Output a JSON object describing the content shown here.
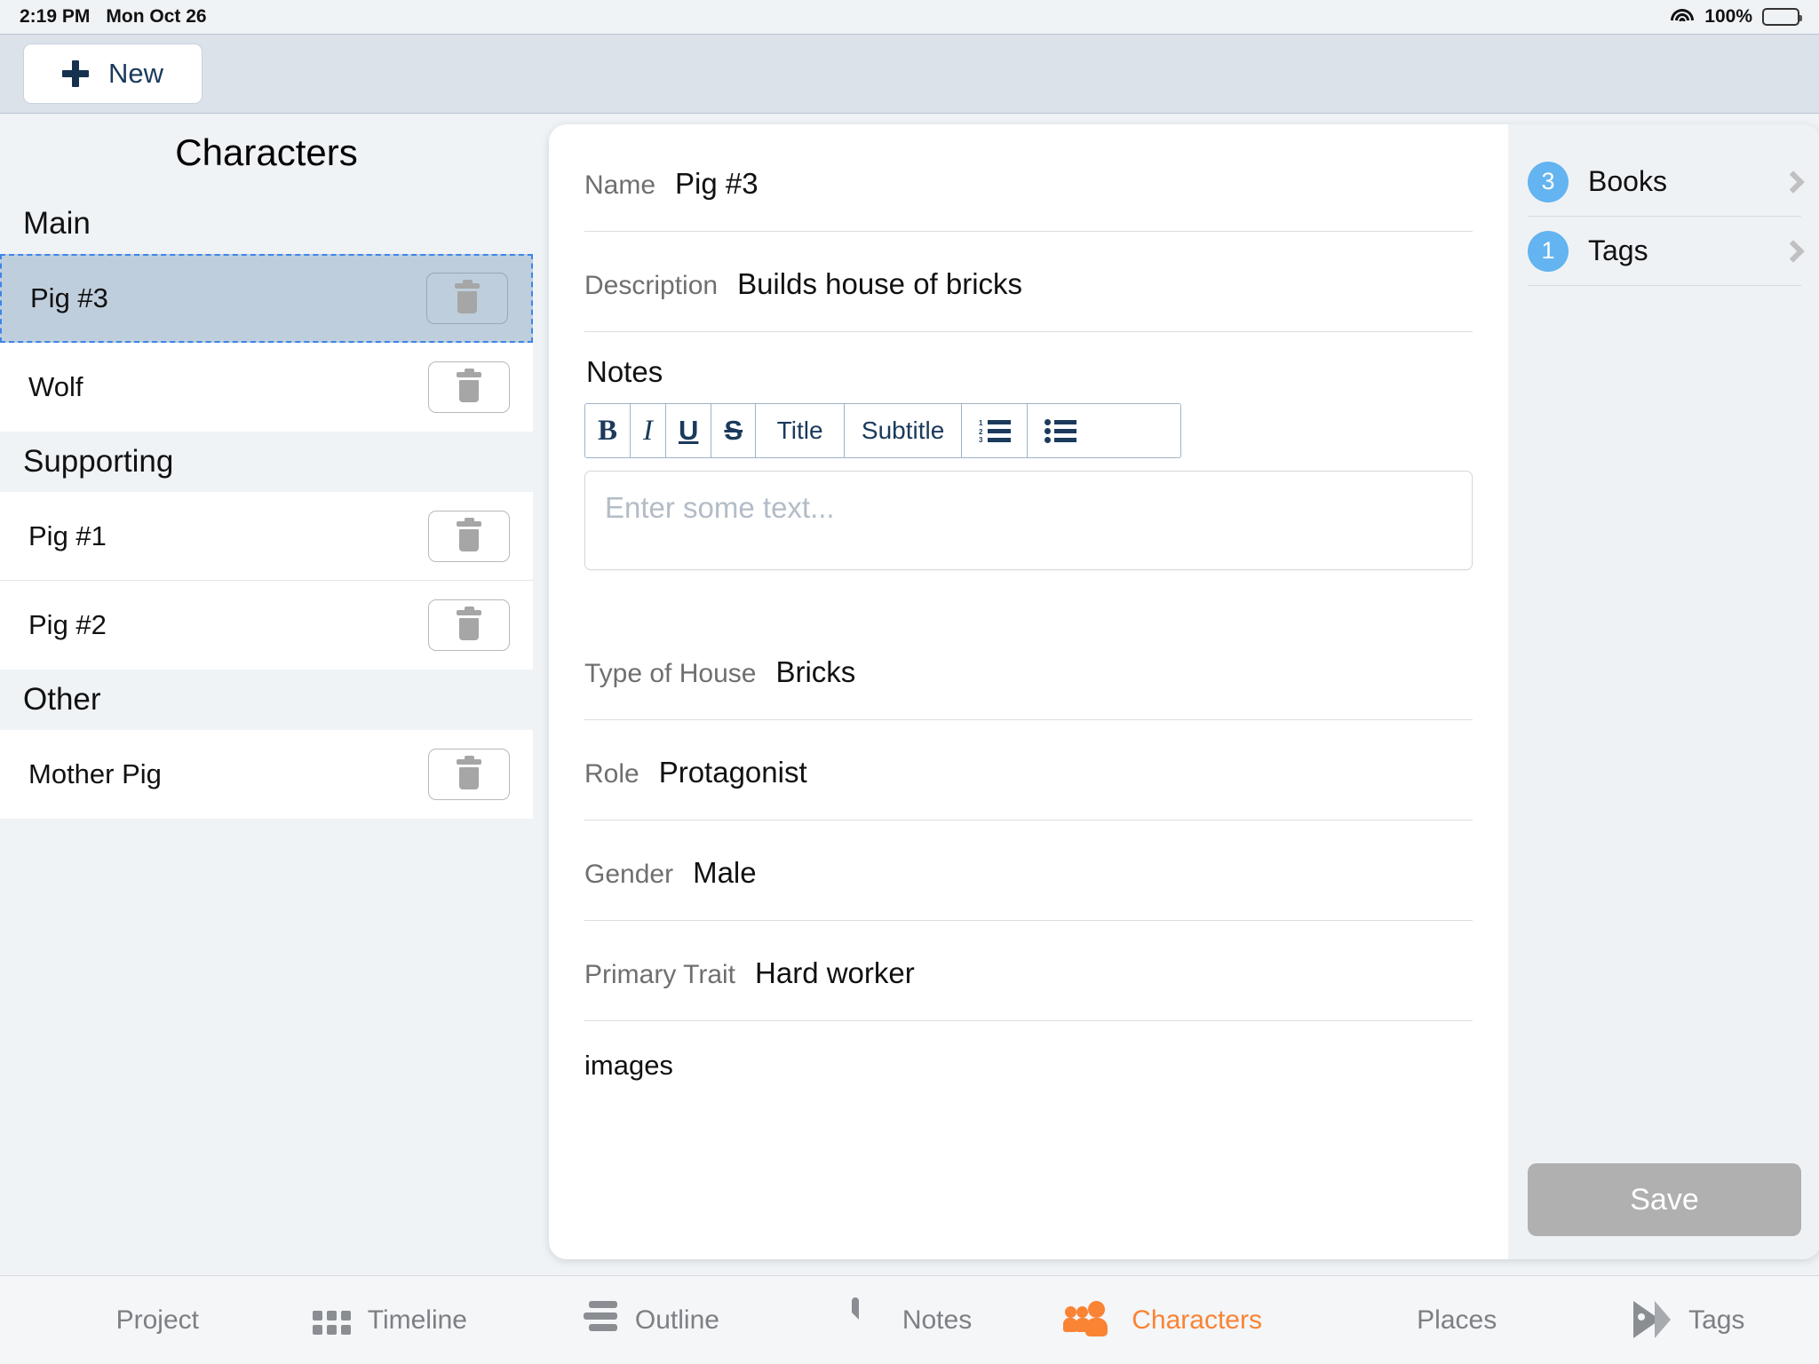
{
  "status_bar": {
    "time": "2:19 PM",
    "date": "Mon Oct 26",
    "battery_percent": "100%",
    "wifi_icon": "wifi-icon",
    "battery_icon": "battery-full-icon"
  },
  "nav_bar": {
    "new_label": "New",
    "plus_icon": "plus-icon"
  },
  "sidebar": {
    "title": "Characters",
    "delete_icon": "trash-icon",
    "groups": [
      {
        "header": "Main",
        "items": [
          {
            "name": "Pig #3",
            "selected": true
          },
          {
            "name": "Wolf",
            "selected": false
          }
        ]
      },
      {
        "header": "Supporting",
        "items": [
          {
            "name": "Pig #1",
            "selected": false
          },
          {
            "name": "Pig #2",
            "selected": false
          }
        ]
      },
      {
        "header": "Other",
        "items": [
          {
            "name": "Mother Pig",
            "selected": false
          }
        ]
      }
    ]
  },
  "detail": {
    "name_label": "Name",
    "name_value": "Pig #3",
    "description_label": "Description",
    "description_value": "Builds house of bricks",
    "notes_label": "Notes",
    "notes_placeholder": "Enter some text...",
    "notes_value": "",
    "toolbar": {
      "bold": "B",
      "italic": "I",
      "underline": "U",
      "strikethrough": "S",
      "title": "Title",
      "subtitle": "Subtitle",
      "ordered_list_icon": "ordered-list-icon",
      "bullet_list_icon": "bullet-list-icon"
    },
    "type_of_house_label": "Type of House",
    "type_of_house_value": "Bricks",
    "role_label": "Role",
    "role_value": "Protagonist",
    "gender_label": "Gender",
    "gender_value": "Male",
    "primary_trait_label": "Primary Trait",
    "primary_trait_value": "Hard worker",
    "images_label": "images"
  },
  "right_panel": {
    "books_count": "3",
    "books_label": "Books",
    "tags_count": "1",
    "tags_label": "Tags",
    "chevron_icon": "chevron-right-icon",
    "save_label": "Save"
  },
  "tab_bar": {
    "tabs": [
      {
        "label": "Project",
        "icon": "book-icon",
        "active": false
      },
      {
        "label": "Timeline",
        "icon": "grid-icon",
        "active": false
      },
      {
        "label": "Outline",
        "icon": "bars-icon",
        "active": false
      },
      {
        "label": "Notes",
        "icon": "page-icon",
        "active": false
      },
      {
        "label": "Characters",
        "icon": "people-icon",
        "active": true
      },
      {
        "label": "Places",
        "icon": "globe-icon",
        "active": false
      },
      {
        "label": "Tags",
        "icon": "tag-icon",
        "active": false
      }
    ]
  },
  "colors": {
    "accent_orange": "#FA8334",
    "badge_blue": "#63B4F0",
    "selection_blue": "#BFCEDD",
    "selection_border": "#3C86E8",
    "nav_bar": "#DCE2EA",
    "save_disabled": "#B0B0B0"
  }
}
